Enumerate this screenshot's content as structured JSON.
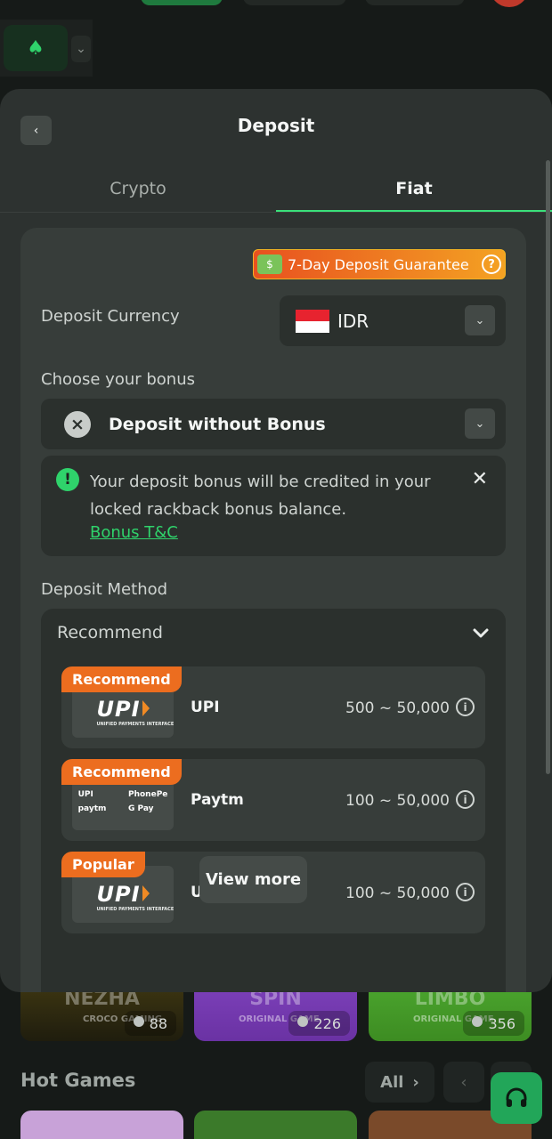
{
  "background": {
    "tiles": [
      {
        "name": "NEZHA",
        "sub": "CROCO GAMING",
        "count": "88",
        "color": "#3b3411"
      },
      {
        "name": "SPIN",
        "sub": "ORIGINAL GAME",
        "count": "226",
        "color": "#7b3fb8"
      },
      {
        "name": "LIMBO",
        "sub": "ORIGINAL GAME",
        "count": "356",
        "color": "#4aa32d"
      }
    ],
    "hot_games": "Hot Games",
    "all_label": "All"
  },
  "modal": {
    "title": "Deposit",
    "tabs": [
      {
        "label": "Crypto",
        "active": false
      },
      {
        "label": "Fiat",
        "active": true
      }
    ],
    "guarantee": "7-Day Deposit Guarantee",
    "currency_label": "Deposit Currency",
    "currency_value": "IDR",
    "bonus_label": "Choose your bonus",
    "bonus_value": "Deposit without Bonus",
    "notice": {
      "message": "Your deposit bonus will be credited in your locked rackback bonus balance.",
      "link": "Bonus T&C"
    },
    "method_label": "Deposit Method",
    "method_group": "Recommend",
    "methods": [
      {
        "tag": "Recommend",
        "name": "UPI",
        "range": "500 ~ 50,000",
        "logo": "upi"
      },
      {
        "tag": "Recommend",
        "name": "Paytm",
        "range": "100 ~ 50,000",
        "logo": "multi"
      },
      {
        "tag": "Popular",
        "name": "UPI",
        "range": "100 ~ 50,000",
        "logo": "upi"
      }
    ],
    "view_more": "View more"
  },
  "logos": {
    "upi_text": "UPI",
    "upi_sub": "UNIFIED PAYMENTS INTERFACE",
    "multi": [
      "UPI",
      "PhonePe",
      "paytm",
      "G Pay"
    ]
  },
  "colors": {
    "accent": "#3ae07a",
    "tag_orange": "#ec6d1f",
    "modal_bg": "#2d3230"
  }
}
